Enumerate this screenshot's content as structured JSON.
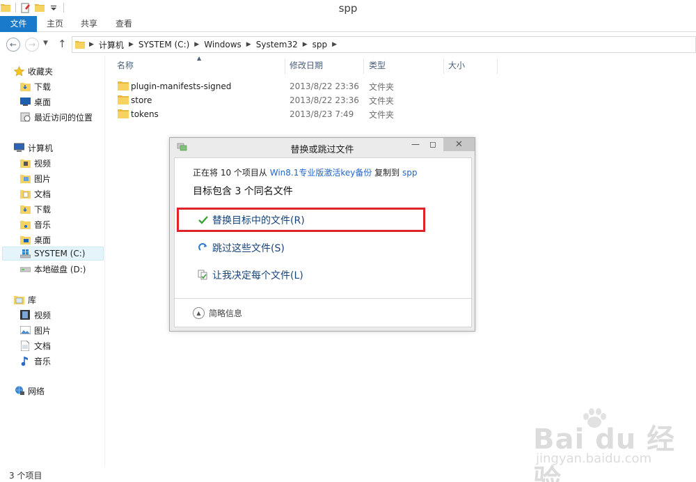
{
  "window": {
    "title": "spp"
  },
  "ribbon": {
    "tabs": [
      "文件",
      "主页",
      "共享",
      "查看"
    ]
  },
  "address": {
    "crumbs": [
      "计算机",
      "SYSTEM (C:)",
      "Windows",
      "System32",
      "spp"
    ]
  },
  "sidebar": {
    "favorites_header": "收藏夹",
    "favorites": [
      "下载",
      "桌面",
      "最近访问的位置"
    ],
    "computer_header": "计算机",
    "computer": [
      "视频",
      "图片",
      "文档",
      "下载",
      "音乐",
      "桌面",
      "SYSTEM (C:)",
      "本地磁盘 (D:)"
    ],
    "libraries_header": "库",
    "libraries": [
      "视频",
      "图片",
      "文档",
      "音乐"
    ],
    "network": "网络"
  },
  "columns": {
    "name": "名称",
    "date": "修改日期",
    "type": "类型",
    "size": "大小"
  },
  "files": [
    {
      "name": "plugin-manifests-signed",
      "date": "2013/8/22 23:36",
      "type": "文件夹"
    },
    {
      "name": "store",
      "date": "2013/8/22 23:36",
      "type": "文件夹"
    },
    {
      "name": "tokens",
      "date": "2013/8/23 7:49",
      "type": "文件夹"
    }
  ],
  "status": {
    "count": "3 个项目"
  },
  "dialog": {
    "title": "替换或跳过文件",
    "copying_prefix": "正在将 10 个项目从 ",
    "copying_source": "Win8.1专业版激活key备份",
    "copying_mid": " 复制到 ",
    "copying_dest": "spp",
    "conflict_text": "目标包含 3 个同名文件",
    "option_replace": "替换目标中的文件(R)",
    "option_skip": "跳过这些文件(S)",
    "option_decide": "让我决定每个文件(L)",
    "details": "简略信息"
  },
  "watermark": {
    "brand": "Bai du 经验",
    "site": "jingyan.baidu.com"
  },
  "colors": {
    "file_tab": "#1979ca",
    "highlight_box": "#e0232a",
    "link": "#2266cc"
  }
}
